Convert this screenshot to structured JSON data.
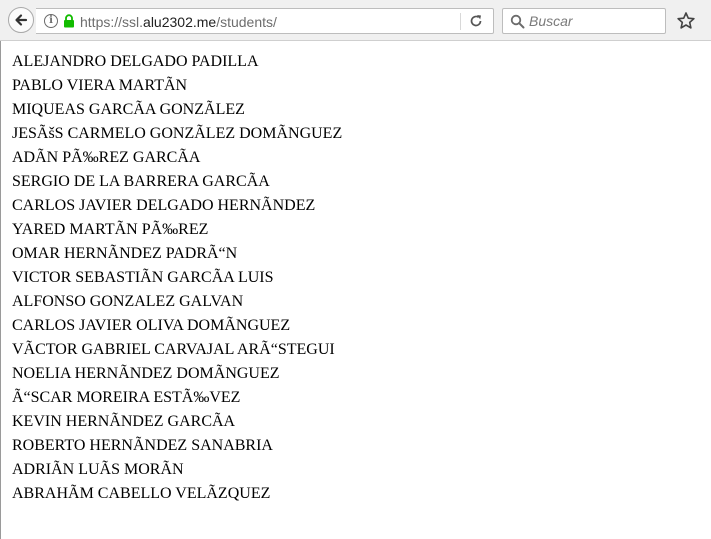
{
  "browser": {
    "url_scheme": "https://ssl.",
    "url_host": "alu2302.me",
    "url_path": "/students/",
    "search_placeholder": "Buscar",
    "info_glyph": "i"
  },
  "students": [
    "ALEJANDRO DELGADO PADILLA",
    "PABLO VIERA MARTÃN",
    "MIQUEAS GARCÃA GONZÃLEZ",
    "JESÃšS CARMELO GONZÃLEZ DOMÃNGUEZ",
    "ADÃN PÃ‰REZ GARCÃA",
    "SERGIO DE LA BARRERA GARCÃA",
    "CARLOS JAVIER DELGADO HERNÃNDEZ",
    "YARED MARTÃN PÃ‰REZ",
    "OMAR HERNÃNDEZ PADRÃ“N",
    "VICTOR SEBASTIÃN GARCÃA LUIS",
    "ALFONSO GONZALEZ GALVAN",
    "CARLOS JAVIER OLIVA DOMÃNGUEZ",
    "VÃCTOR GABRIEL CARVAJAL ARÃ“STEGUI",
    "NOELIA HERNÃNDEZ DOMÃNGUEZ",
    "Ã“SCAR MOREIRA ESTÃ‰VEZ",
    "KEVIN HERNÃNDEZ GARCÃA",
    "ROBERTO HERNÃNDEZ SANABRIA",
    "ADRIÃN LUÃS MORÃN",
    "ABRAHÃM CABELLO VELÃZQUEZ"
  ]
}
